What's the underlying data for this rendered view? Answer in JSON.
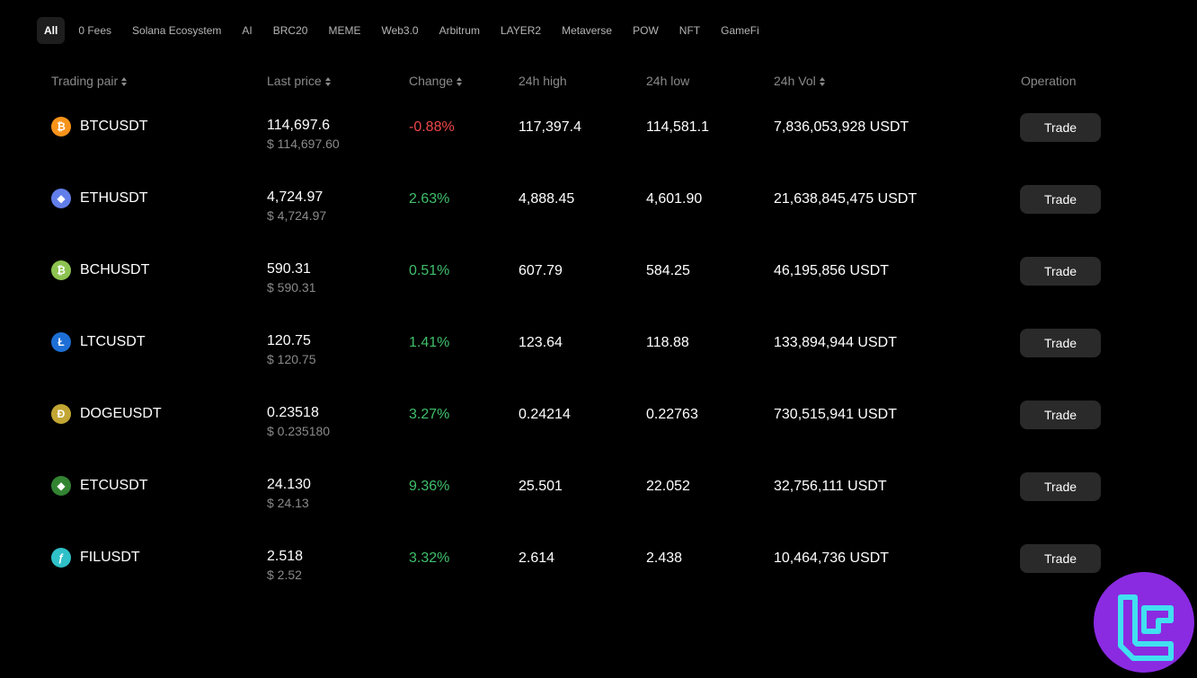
{
  "tabs": [
    {
      "label": "All",
      "active": true
    },
    {
      "label": "0 Fees"
    },
    {
      "label": "Solana Ecosystem"
    },
    {
      "label": "AI"
    },
    {
      "label": "BRC20"
    },
    {
      "label": "MEME"
    },
    {
      "label": "Web3.0"
    },
    {
      "label": "Arbitrum"
    },
    {
      "label": "LAYER2"
    },
    {
      "label": "Metaverse"
    },
    {
      "label": "POW"
    },
    {
      "label": "NFT"
    },
    {
      "label": "GameFi"
    }
  ],
  "columns": {
    "pair": "Trading pair",
    "last_price": "Last price",
    "change": "Change",
    "high": "24h high",
    "low": "24h low",
    "vol": "24h Vol",
    "operation": "Operation"
  },
  "colors": {
    "positive": "#3fbf6a",
    "negative": "#f0474b",
    "button_bg": "#2a2a2a"
  },
  "rows": [
    {
      "pair": "BTCUSDT",
      "icon": "bitcoin-icon",
      "icon_color": "#f7931a",
      "icon_glyph": "₿",
      "price": "114,697.6",
      "price_usd": "$ 114,697.60",
      "change": "-0.88%",
      "direction": "down",
      "high": "117,397.4",
      "low": "114,581.1",
      "vol": "7,836,053,928 USDT",
      "action": "Trade"
    },
    {
      "pair": "ETHUSDT",
      "icon": "ethereum-icon",
      "icon_color": "#627eea",
      "icon_glyph": "◆",
      "price": "4,724.97",
      "price_usd": "$ 4,724.97",
      "change": "2.63%",
      "direction": "up",
      "high": "4,888.45",
      "low": "4,601.90",
      "vol": "21,638,845,475 USDT",
      "action": "Trade"
    },
    {
      "pair": "BCHUSDT",
      "icon": "bitcoin-cash-icon",
      "icon_color": "#8dc351",
      "icon_glyph": "₿",
      "price": "590.31",
      "price_usd": "$ 590.31",
      "change": "0.51%",
      "direction": "up",
      "high": "607.79",
      "low": "584.25",
      "vol": "46,195,856 USDT",
      "action": "Trade"
    },
    {
      "pair": "LTCUSDT",
      "icon": "litecoin-icon",
      "icon_color": "#1d6fd6",
      "icon_glyph": "Ł",
      "price": "120.75",
      "price_usd": "$ 120.75",
      "change": "1.41%",
      "direction": "up",
      "high": "123.64",
      "low": "118.88",
      "vol": "133,894,944 USDT",
      "action": "Trade"
    },
    {
      "pair": "DOGEUSDT",
      "icon": "dogecoin-icon",
      "icon_color": "#c2a633",
      "icon_glyph": "Ð",
      "price": "0.23518",
      "price_usd": "$ 0.235180",
      "change": "3.27%",
      "direction": "up",
      "high": "0.24214",
      "low": "0.22763",
      "vol": "730,515,941 USDT",
      "action": "Trade"
    },
    {
      "pair": "ETCUSDT",
      "icon": "ethereum-classic-icon",
      "icon_color": "#328332",
      "icon_glyph": "◆",
      "price": "24.130",
      "price_usd": "$ 24.13",
      "change": "9.36%",
      "direction": "up",
      "high": "25.501",
      "low": "22.052",
      "vol": "32,756,111 USDT",
      "action": "Trade"
    },
    {
      "pair": "FILUSDT",
      "icon": "filecoin-icon",
      "icon_color": "#2fc0c8",
      "icon_glyph": "ƒ",
      "price": "2.518",
      "price_usd": "$ 2.52",
      "change": "3.32%",
      "direction": "up",
      "high": "2.614",
      "low": "2.438",
      "vol": "10,464,736 USDT",
      "action": "Trade"
    }
  ]
}
